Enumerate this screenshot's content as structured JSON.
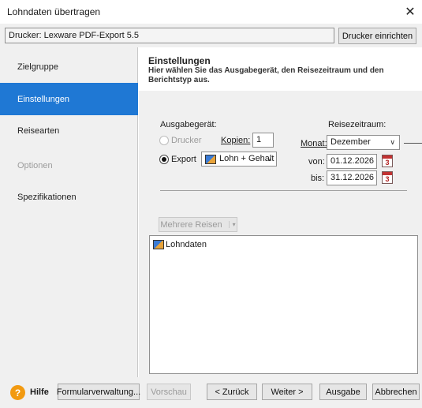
{
  "window": {
    "title": "Lohndaten übertragen",
    "close_glyph": "✕"
  },
  "printer": {
    "label": "Drucker:  Lexware PDF-Export 5.5",
    "setup_button": "Drucker einrichten"
  },
  "sidebar": {
    "items": [
      {
        "label": "Zielgruppe",
        "state": "normal"
      },
      {
        "label": "Einstellungen",
        "state": "active"
      },
      {
        "label": "Reisearten",
        "state": "normal"
      },
      {
        "label": "Optionen",
        "state": "disabled"
      },
      {
        "label": "Spezifikationen",
        "state": "normal"
      }
    ]
  },
  "header": {
    "title": "Einstellungen",
    "description": "Hier wählen Sie das Ausgabegerät, den Reisezeitraum und den Berichtstyp aus."
  },
  "output": {
    "section_label": "Ausgabegerät:",
    "printer_radio": "Drucker",
    "copies_label": "Kopien:",
    "copies_value": "1",
    "export_radio": "Export",
    "export_value": "Lohn + Gehalt",
    "selected": "Export"
  },
  "period": {
    "section_label": "Reisezeitraum:",
    "month_label": "Monat:",
    "month_value": "Dezember",
    "from_label": "von:",
    "from_value": "01.12.2026",
    "to_label": "bis:",
    "to_value": "31.12.2026",
    "calendar_number": "3"
  },
  "multi_button": "Mehrere Reisen",
  "list": {
    "items": [
      "Lohndaten"
    ]
  },
  "footer": {
    "help": "Hilfe",
    "help_glyph": "?",
    "form_admin": "Formularverwaltung...",
    "preview": "Vorschau",
    "back": "< Zurück",
    "next": "Weiter >",
    "output": "Ausgabe",
    "cancel": "Abbrechen"
  },
  "colors": {
    "accent": "#1f78d4",
    "help": "#f29a11"
  }
}
